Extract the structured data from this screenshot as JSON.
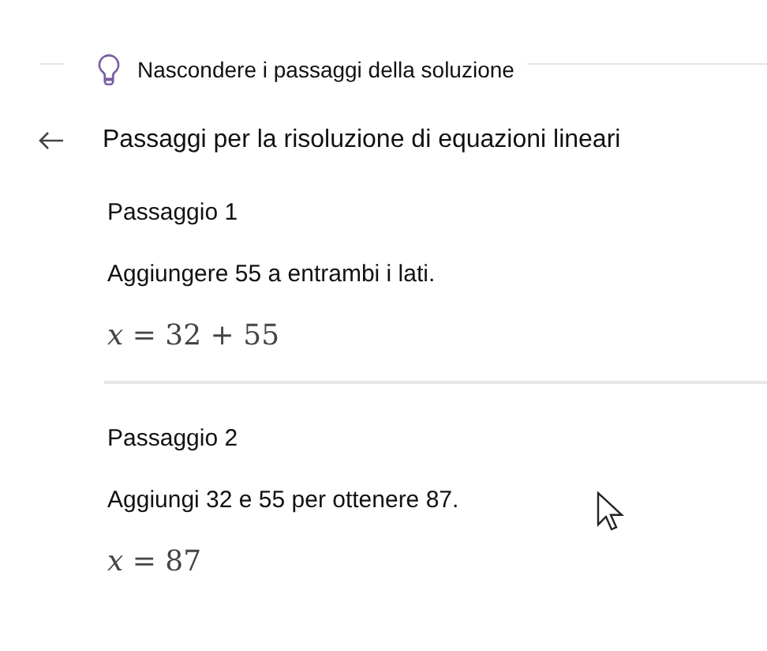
{
  "hint_toggle": {
    "label": "Nascondere i passaggi della soluzione"
  },
  "header": {
    "title": "Passaggi per la risoluzione di equazioni lineari"
  },
  "steps": [
    {
      "heading": "Passaggio 1",
      "description": "Aggiungere 55 a entrambi i lati.",
      "formula": "*x* = 32 + 55"
    },
    {
      "heading": "Passaggio 2",
      "description": "Aggiungi 32 e 55 per ottenere 87.",
      "formula": "*x* = 87"
    }
  ]
}
